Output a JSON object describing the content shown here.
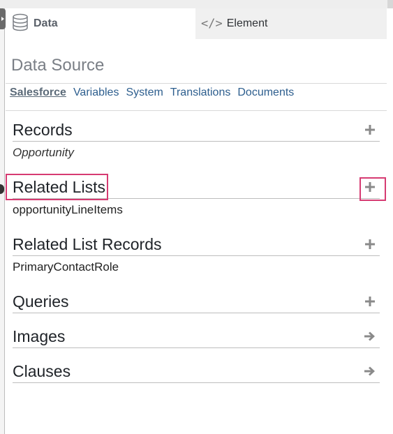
{
  "tabs": {
    "data": {
      "label": "Data",
      "icon": "database-icon"
    },
    "element": {
      "label": "Element",
      "icon": "code-icon"
    }
  },
  "panel": {
    "title": "Data Source",
    "subnav": [
      "Salesforce",
      "Variables",
      "System",
      "Translations",
      "Documents"
    ],
    "active_subnav": "Salesforce"
  },
  "sections": [
    {
      "title": "Records",
      "action": "plus",
      "item": "Opportunity"
    },
    {
      "title": "Related Lists",
      "action": "plus",
      "item": "opportunityLineItems"
    },
    {
      "title": "Related List Records",
      "action": "plus",
      "item": "PrimaryContactRole"
    },
    {
      "title": "Queries",
      "action": "plus"
    },
    {
      "title": "Images",
      "action": "arrow"
    },
    {
      "title": "Clauses",
      "action": "arrow"
    }
  ],
  "colors": {
    "highlight": "#d63b72",
    "link": "#2d5e8e"
  }
}
